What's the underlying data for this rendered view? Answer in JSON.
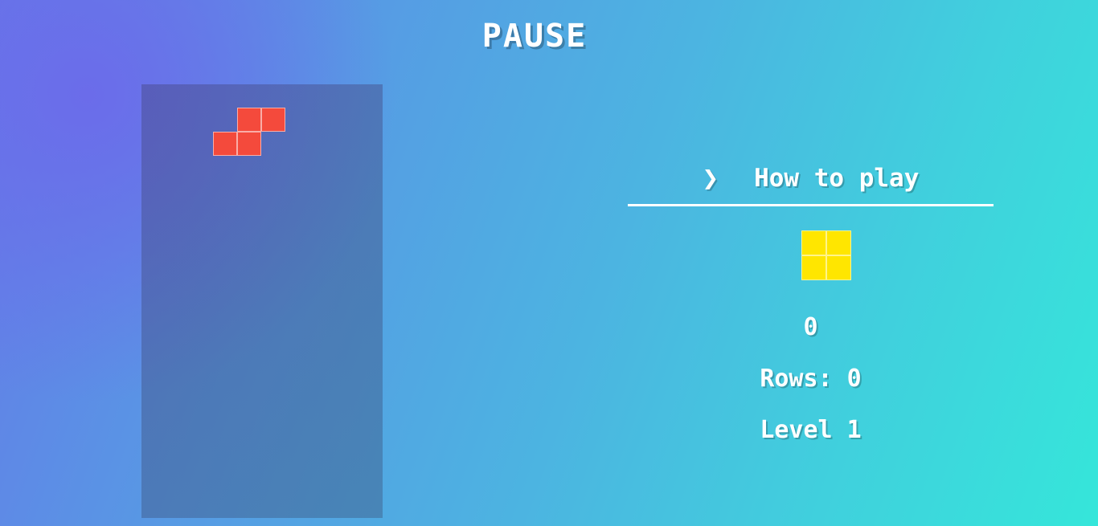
{
  "title": "PAUSE",
  "colors": {
    "active_piece": "#f44a3c",
    "next_piece": "#ffe600"
  },
  "board": {
    "columns": 10,
    "rows": 18,
    "active_piece": {
      "type": "S",
      "cells": [
        [
          4,
          0
        ],
        [
          5,
          0
        ],
        [
          3,
          1
        ],
        [
          4,
          1
        ]
      ]
    }
  },
  "sidebar": {
    "how_to_play_icon": "chevron-right-icon",
    "how_to_play_label": "How to play",
    "next_piece": {
      "type": "O",
      "cells": [
        [
          0,
          0
        ],
        [
          1,
          0
        ],
        [
          0,
          1
        ],
        [
          1,
          1
        ]
      ]
    },
    "score": "0",
    "rows_label": "Rows:",
    "rows_value": "0",
    "level_label": "Level",
    "level_value": "1"
  }
}
